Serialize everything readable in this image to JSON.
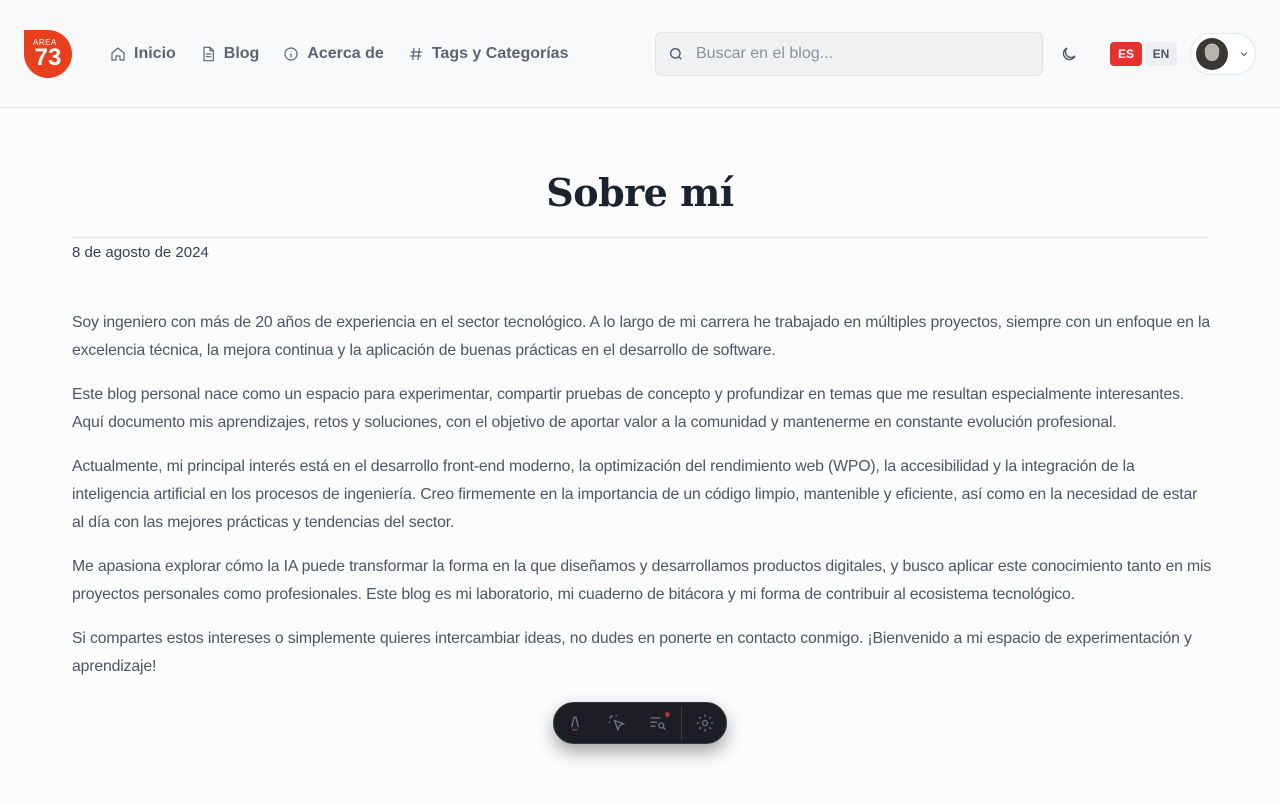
{
  "logo": {
    "small": "AREA",
    "big": "73"
  },
  "nav": [
    {
      "label": "Inicio",
      "icon": "home-icon"
    },
    {
      "label": "Blog",
      "icon": "document-icon"
    },
    {
      "label": "Acerca de",
      "icon": "info-icon"
    },
    {
      "label": "Tags y Categorías",
      "icon": "hash-icon"
    }
  ],
  "search": {
    "placeholder": "Buscar en el blog..."
  },
  "languages": {
    "es": "ES",
    "en": "EN",
    "active": "ES"
  },
  "colors": {
    "accent": "#e8401c",
    "lang_active": "#e5322d",
    "text": "#4b5563"
  },
  "page": {
    "title": "Sobre mí",
    "date": "8 de agosto de 2024",
    "paragraphs": [
      "Soy ingeniero con más de 20 años de experiencia en el sector tecnológico. A lo largo de mi carrera he trabajado en múltiples proyectos, siempre con un enfoque en la excelencia técnica, la mejora continua y la aplicación de buenas prácticas en el desarrollo de software.",
      "Este blog personal nace como un espacio para experimentar, compartir pruebas de concepto y profundizar en temas que me resultan especialmente interesantes. Aquí documento mis aprendizajes, retos y soluciones, con el objetivo de aportar valor a la comunidad y mantenerme en constante evolución profesional.",
      "Actualmente, mi principal interés está en el desarrollo front-end moderno, la optimización del rendimiento web (WPO), la accesibilidad y la integración de la inteligencia artificial en los procesos de ingeniería. Creo firmemente en la importancia de un código limpio, mantenible y eficiente, así como en la necesidad de estar al día con las mejores prácticas y tendencias del sector.",
      "Me apasiona explorar cómo la IA puede transformar la forma en la que diseñamos y desarrollamos productos digitales, y busco aplicar este conocimiento tanto en mis proyectos personales como profesionales. Este blog es mi laboratorio, mi cuaderno de bitácora y mi forma de contribuir al ecosistema tecnológico.",
      "Si compartes estos intereses o simplemente quieres intercambiar ideas, no dudes en ponerte en contacto conmigo. ¡Bienvenido a mi espacio de experimentación y aprendizaje!"
    ]
  },
  "dev_toolbar": {
    "icons": [
      "astro-icon",
      "inspect-cursor-icon",
      "audit-list-icon",
      "settings-gear-icon"
    ]
  }
}
